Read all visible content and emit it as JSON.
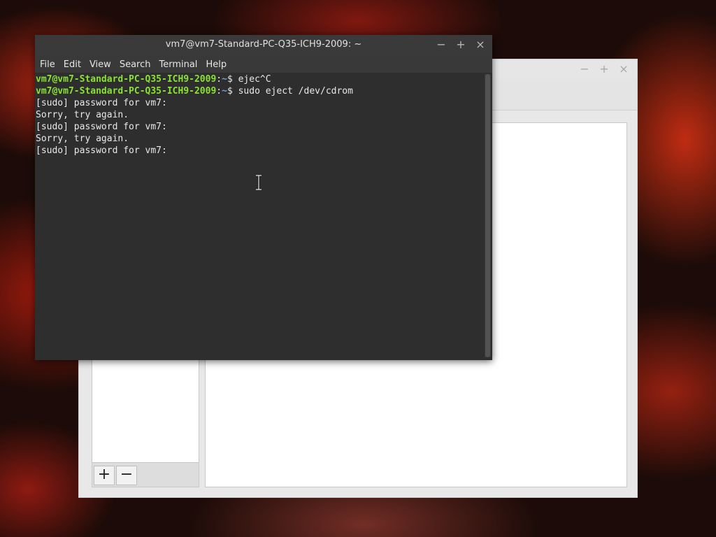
{
  "background_window": {
    "controls": {
      "minimize": "−",
      "maximize": "+",
      "close": "×"
    },
    "add_button": "+",
    "remove_button": "−"
  },
  "terminal": {
    "title": "vm7@vm7-Standard-PC-Q35-ICH9-2009: ~",
    "controls": {
      "minimize": "−",
      "maximize": "+",
      "close": "×"
    },
    "menu": [
      "File",
      "Edit",
      "View",
      "Search",
      "Terminal",
      "Help"
    ],
    "lines": [
      {
        "user": "vm7@vm7-Standard-PC-Q35-ICH9-2009",
        "sep": ":",
        "path": "~",
        "cmd": "$ ejec^C"
      },
      {
        "user": "vm7@vm7-Standard-PC-Q35-ICH9-2009",
        "sep": ":",
        "path": "~",
        "cmd": "$ sudo eject /dev/cdrom"
      },
      {
        "text": "[sudo] password for vm7:"
      },
      {
        "text": "Sorry, try again."
      },
      {
        "text": "[sudo] password for vm7:"
      },
      {
        "text": "Sorry, try again."
      },
      {
        "text": "[sudo] password for vm7:"
      }
    ]
  },
  "colors": {
    "prompt_user": "#8ae234",
    "prompt_path": "#729fcf",
    "terminal_bg": "#2e2e2e"
  }
}
